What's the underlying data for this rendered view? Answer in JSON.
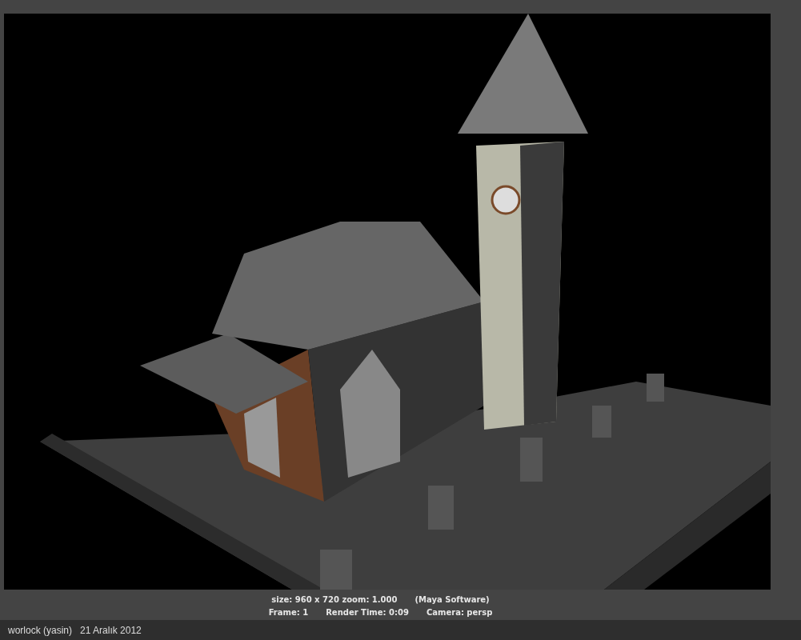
{
  "render_view": {
    "image": {
      "kind": "picture"
    },
    "info_lines": [
      [
        "size: 960 x 720 zoom: 1.000",
        "(Maya Software)"
      ],
      [
        "Frame: 1",
        "Render Time: 0:09",
        "Camera: persp"
      ]
    ]
  },
  "caption": {
    "author": "worlock (yasin)",
    "date": "21 Aralık 2012"
  }
}
